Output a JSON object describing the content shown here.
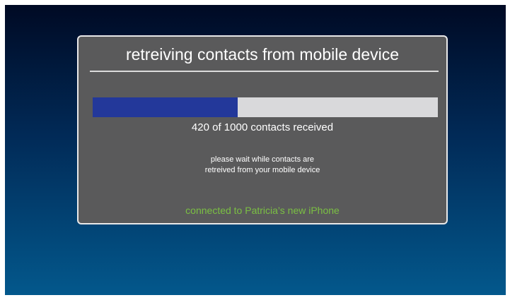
{
  "dialog": {
    "title": "retreiving contacts from mobile device",
    "progress": {
      "received": 420,
      "total": 1000,
      "fraction": 0.42,
      "label": "420 of 1000 contacts received",
      "fill_color": "#23389a",
      "track_color": "#d9d9db"
    },
    "wait_message": {
      "line1": "please wait while contacts are",
      "line2": "retreived from your mobile device"
    },
    "connection_status": "connected to Patricia’s new iPhone",
    "status_color": "#7bc043"
  }
}
